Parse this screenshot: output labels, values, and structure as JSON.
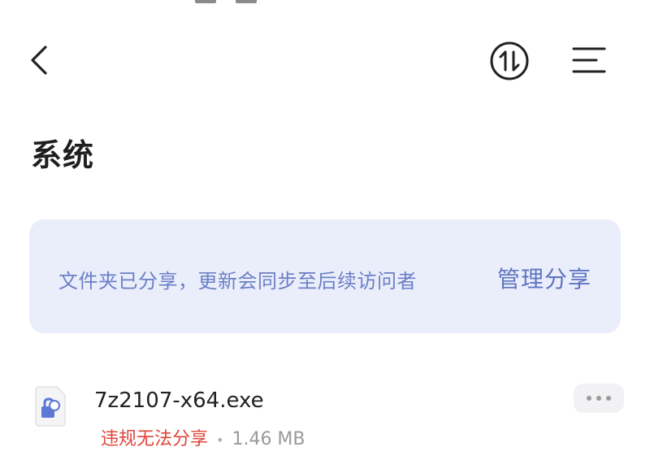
{
  "header": {
    "title": "系统",
    "icons": {
      "back": "chevron-left-icon",
      "sort": "sort-arrows-icon",
      "menu": "menu-icon"
    }
  },
  "share_banner": {
    "notice": "文件夹已分享，更新会同步至后续访问者",
    "manage_label": "管理分享",
    "text_color": "#6c7fc6",
    "background": "#eaeefb"
  },
  "files": [
    {
      "name": "7z2107-x64.exe",
      "status": "违规无法分享",
      "separator": "•",
      "size": "1.46 MB",
      "status_color": "#e0453a",
      "icon": "file-lock-icon"
    }
  ]
}
